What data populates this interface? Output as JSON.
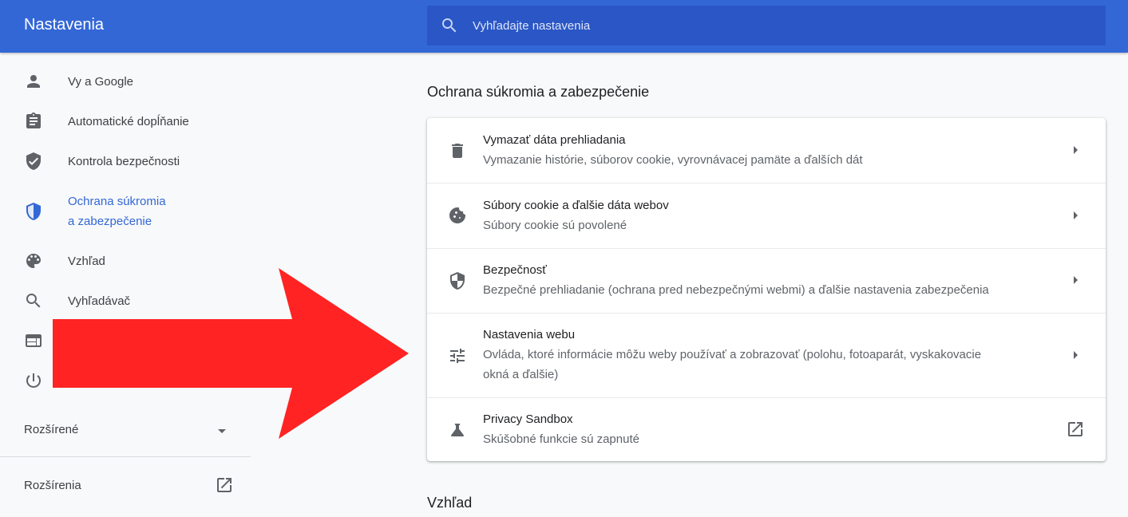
{
  "header": {
    "title": "Nastavenia",
    "search_placeholder": "Vyhľadajte nastavenia"
  },
  "sidebar": {
    "items": [
      {
        "label": "Vy a Google",
        "icon": "person-icon"
      },
      {
        "label": "Automatické dopĺňanie",
        "icon": "clipboard-icon"
      },
      {
        "label": "Kontrola bezpečnosti",
        "icon": "shield-check-icon"
      },
      {
        "label_line1": "Ochrana súkromia",
        "label_line2": "a zabezpečenie",
        "icon": "shield-half-icon",
        "active": true
      },
      {
        "label": "Vzhľad",
        "icon": "palette-icon"
      },
      {
        "label": "Vyhľadávač",
        "icon": "search-icon"
      },
      {
        "label": "",
        "icon": "browser-window-icon"
      },
      {
        "label": "",
        "icon": "power-icon"
      }
    ],
    "advanced_label": "Rozšírené",
    "extensions_label": "Rozšírenia"
  },
  "main": {
    "section_title": "Ochrana súkromia a zabezpečenie",
    "rows": [
      {
        "title": "Vymazať dáta prehliadania",
        "subtitle": "Vymazanie histórie, súborov cookie, vyrovnávacej pamäte a ďalších dát",
        "icon": "trash-icon"
      },
      {
        "title": "Súbory cookie a ďalšie dáta webov",
        "subtitle": "Súbory cookie sú povolené",
        "icon": "cookie-icon"
      },
      {
        "title": "Bezpečnosť",
        "subtitle": "Bezpečné prehliadanie (ochrana pred nebezpečnými webmi) a ďalšie nastavenia zabezpečenia",
        "icon": "shield-icon"
      },
      {
        "title": "Nastavenia webu",
        "subtitle_line1": "Ovláda, ktoré informácie môžu weby používať a zobrazovať (polohu, fotoaparát, vyskakovacie",
        "subtitle_line2": "okná a ďalšie)",
        "icon": "tune-sliders-icon"
      },
      {
        "title": "Privacy Sandbox",
        "subtitle": "Skúšobné funkcie sú zapnuté",
        "icon": "flask-icon"
      }
    ],
    "next_section_title": "Vzhľad"
  },
  "colors": {
    "header_bg": "#3367d6",
    "search_bg": "#2a56c6",
    "active_nav": "#3367d6",
    "annotation_arrow": "#ff2323"
  }
}
